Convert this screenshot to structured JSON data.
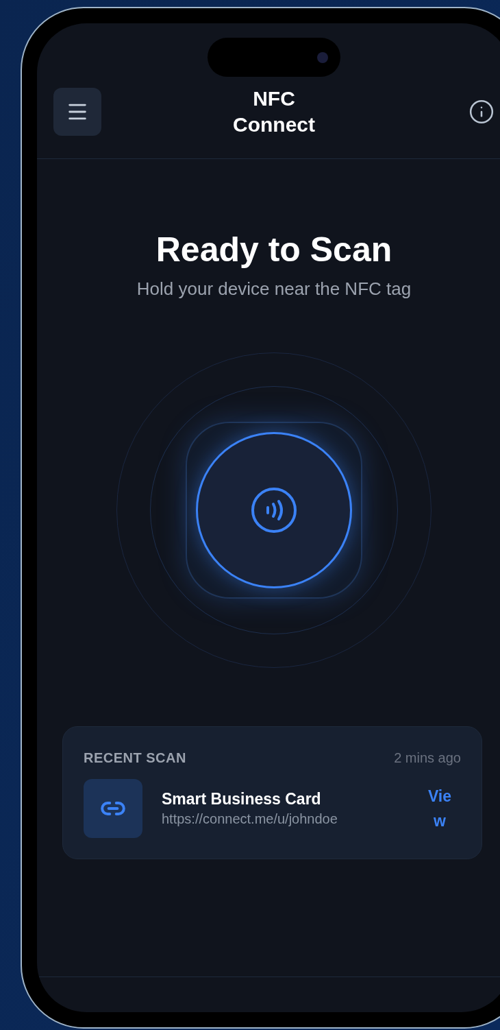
{
  "header": {
    "title": "NFC Connect"
  },
  "scanner": {
    "title": "Ready to Scan",
    "subtitle": "Hold your device near the NFC tag"
  },
  "recent_scan": {
    "heading": "RECENT SCAN",
    "time": "2 mins ago",
    "item": {
      "title": "Smart Business Card",
      "url": "https://connect.me/u/johndoe",
      "action": "View"
    }
  }
}
